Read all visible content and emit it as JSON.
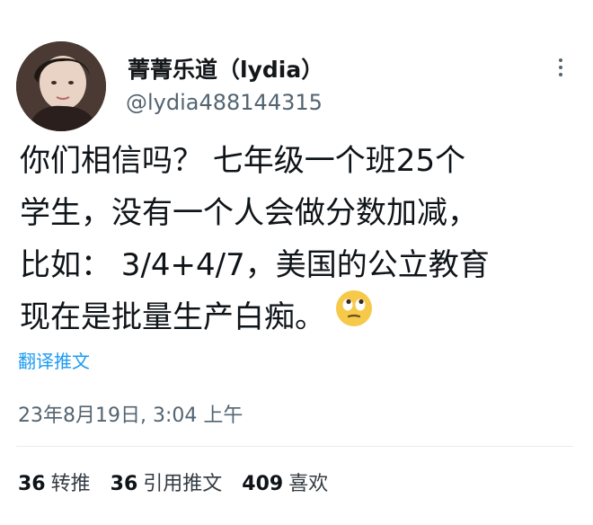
{
  "author": {
    "display_name": "菁菁乐道（lydia）",
    "handle": "@lydia488144315"
  },
  "tweet": {
    "lines": [
      "你们相信吗？ 七年级一个班25个",
      "学生，没有一个人会做分数加减，",
      "比如： 3/4+4/7，美国的公立教育",
      "现在是批量生产白痴。"
    ],
    "emoji": "eye-roll-emoji"
  },
  "translate_label": "翻译推文",
  "timestamp": "23年8月19日, 3:04 上午",
  "stats": {
    "retweets": {
      "count": "36",
      "label": "转推"
    },
    "quotes": {
      "count": "36",
      "label": "引用推文"
    },
    "likes": {
      "count": "409",
      "label": "喜欢"
    }
  },
  "colors": {
    "link": "#1d9bf0",
    "secondary_text": "#536471",
    "primary_text": "#0f1419"
  }
}
